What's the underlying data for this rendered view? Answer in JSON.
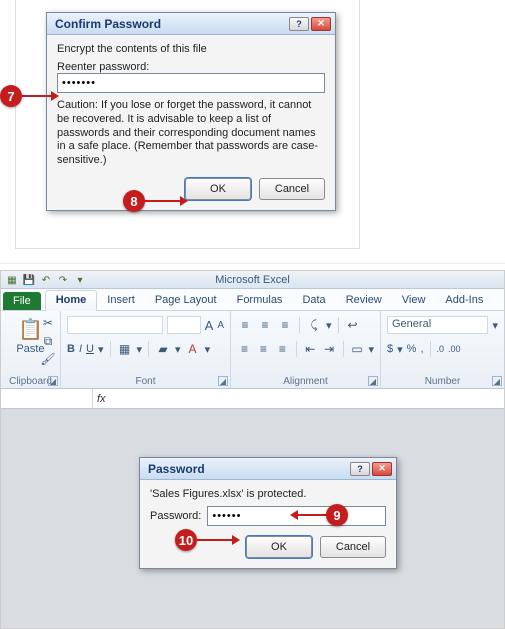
{
  "confirm": {
    "title": "Confirm Password",
    "encrypt": "Encrypt the contents of this file",
    "reenter_label": "Reenter password:",
    "value": "•••••••",
    "caution": "Caution: If you lose or forget the password, it cannot be recovered. It is advisable to keep a list of passwords and their corresponding document names in a safe place. (Remember that passwords are case-sensitive.)",
    "ok": "OK",
    "cancel": "Cancel"
  },
  "callouts": {
    "c7": "7",
    "c8": "8",
    "c9": "9",
    "c10": "10"
  },
  "excel": {
    "app_title": "Microsoft Excel",
    "tabs": {
      "file": "File",
      "home": "Home",
      "insert": "Insert",
      "page_layout": "Page Layout",
      "formulas": "Formulas",
      "data": "Data",
      "review": "Review",
      "view": "View",
      "addins": "Add-Ins"
    },
    "groups": {
      "clipboard": "Clipboard",
      "paste": "Paste",
      "font": "Font",
      "alignment": "Alignment",
      "number": "Number"
    },
    "font_row": {
      "bold": "B",
      "italic": "I",
      "underline": "U"
    },
    "font_size_a_big": "A",
    "font_size_a_small": "A",
    "number_format": "General",
    "currency": "$",
    "percent": "%",
    "comma": ",",
    "dec_inc": ".0",
    "dec_dec": ".00",
    "fx": "fx"
  },
  "password": {
    "title": "Password",
    "protected": "'Sales Figures.xlsx' is protected.",
    "label": "Password:",
    "value": "••••••",
    "ok": "OK",
    "cancel": "Cancel"
  }
}
